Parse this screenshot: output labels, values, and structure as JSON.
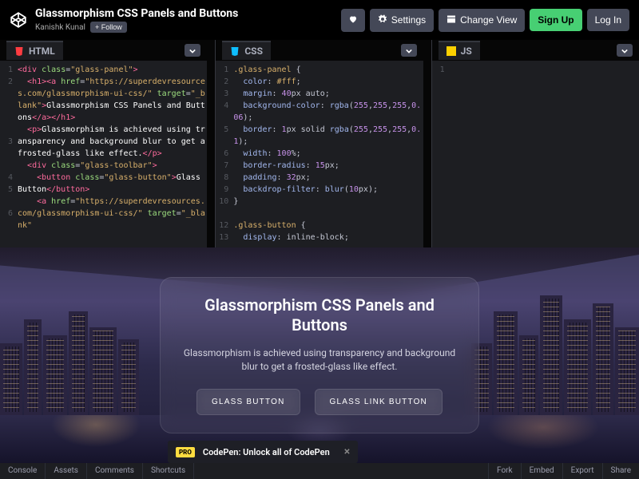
{
  "header": {
    "title": "Glassmorphism CSS Panels and Buttons",
    "author": "Kanishk Kunal",
    "follow": "+ Follow",
    "buttons": {
      "settings": "Settings",
      "changeView": "Change View",
      "signUp": "Sign Up",
      "logIn": "Log In"
    }
  },
  "editors": {
    "html": {
      "label": "HTML"
    },
    "css": {
      "label": "CSS"
    },
    "js": {
      "label": "JS"
    }
  },
  "htmlCode": {
    "l1a": "<div ",
    "l1b": "class",
    "l1c": "=",
    "l1d": "\"glass-panel\"",
    "l1e": ">",
    "l2a": "  <h1><a ",
    "l2b": "href",
    "l2c": "=",
    "l2d": "\"https://superdevresources.com/glassmorphism-ui-css/\"",
    "l2e": " target",
    "l2f": "=",
    "l2g": "\"_blank\"",
    "l2h": ">",
    "l2i": "Glassmorphism CSS Panels and Buttons",
    "l2j": "</a></h1>",
    "l3a": "  <p>",
    "l3b": "Glassmorphism is achieved using transparency and background blur to get a frosted-glass like effect.",
    "l3c": "</p>",
    "l4a": "  <div ",
    "l4b": "class",
    "l4c": "=",
    "l4d": "\"glass-toolbar\"",
    "l4e": ">",
    "l5a": "    <button ",
    "l5b": "class",
    "l5c": "=",
    "l5d": "\"glass-button\"",
    "l5e": ">",
    "l5f": "Glass Button",
    "l5g": "</button>",
    "l6a": "    <a ",
    "l6b": "href",
    "l6c": "=",
    "l6d": "\"https://superdevresources.com/glassmorphism-ui-css/\"",
    "l6e": " target",
    "l6f": "=",
    "l6g": "\"_blank\""
  },
  "cssCode": {
    "sel1": ".glass-panel",
    "ob": " {",
    "p1": "color",
    "v1": "#fff",
    "sc": ";",
    "p2": "margin",
    "v2a": "40",
    "v2b": "px auto",
    "p3": "background-color",
    "v3a": "rgba",
    "v3b": "(",
    "v3c": "255",
    "v3d": ",",
    "v3e": "255",
    "v3f": ",",
    "v3g": "255",
    "v3h": ",",
    "v3i": "0.06",
    "v3j": ")",
    "p4": "border",
    "v4a": "1",
    "v4b": "px solid ",
    "v4c": "rgba",
    "v4d": "(",
    "v4e": "255",
    "v4f": ",",
    "v4g": "255",
    "v4h": ",",
    "v4i": "255",
    "v4j": ",",
    "v4k": "0.1",
    "v4l": ")",
    "p5": "width",
    "v5a": "100",
    "v5b": "%",
    "p6": "border-radius",
    "v6a": "15",
    "v6b": "px",
    "p7": "padding",
    "v7a": "32",
    "v7b": "px",
    "p8": "backdrop-filter",
    "v8a": "blur",
    "v8b": "(",
    "v8c": "10",
    "v8d": "px)",
    "cb": "}",
    "sel2": ".glass-button",
    "p9": "display",
    "v9": "inline-block"
  },
  "preview": {
    "title": "Glassmorphism CSS Panels and Buttons",
    "desc": "Glassmorphism is achieved using transparency and background blur to get a frosted-glass like effect.",
    "btn1": "GLASS BUTTON",
    "btn2": "GLASS LINK BUTTON"
  },
  "promo": {
    "badge": "PRO",
    "text": "CodePen: Unlock all of CodePen"
  },
  "footer": {
    "left": [
      "Console",
      "Assets",
      "Comments",
      "Shortcuts"
    ],
    "right": [
      "Fork",
      "Embed",
      "Export",
      "Share"
    ]
  }
}
